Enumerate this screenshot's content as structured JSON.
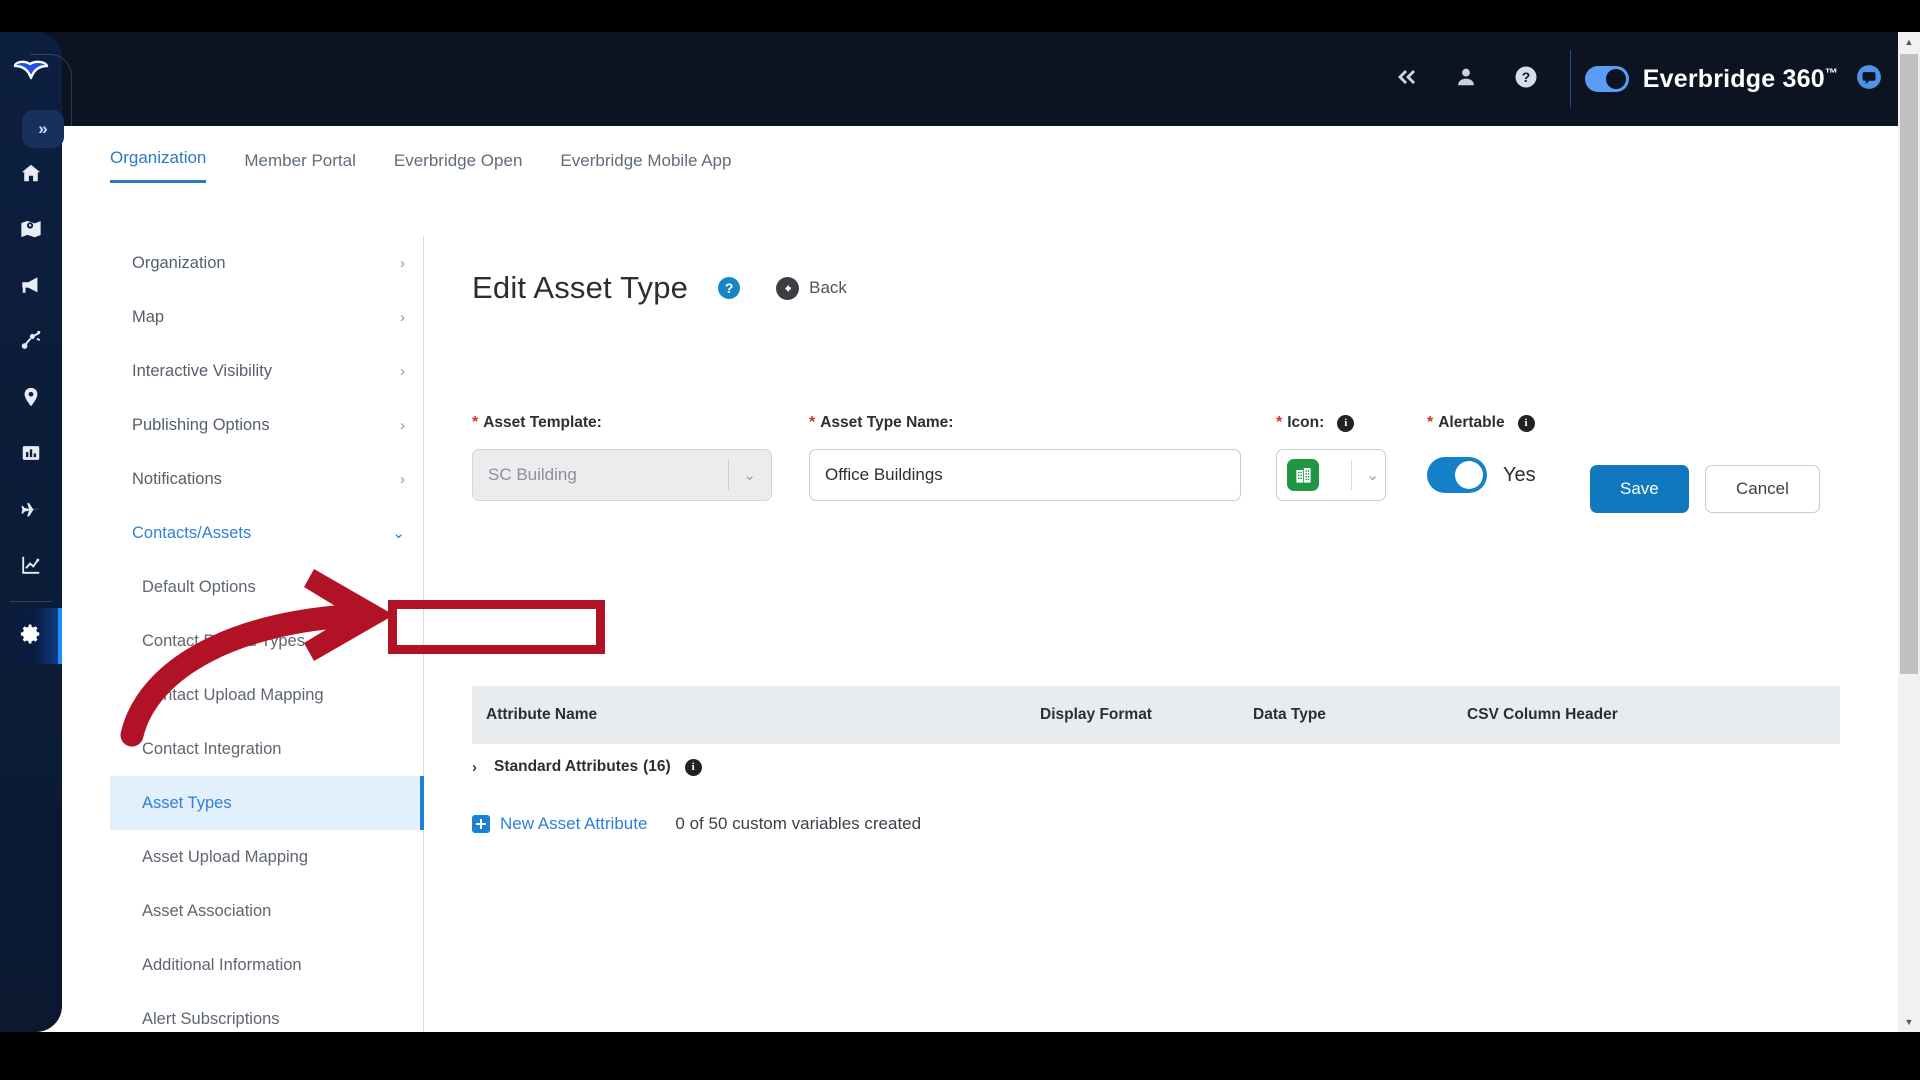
{
  "brand": {
    "name": "Everbridge 360",
    "tm": "™",
    "logo_icon": "everbridge-logo-icon",
    "toggle_on": true
  },
  "topbar": {
    "collapse_icon": "double-chevron-left-icon",
    "user_icon": "user-icon",
    "help_icon": "help-circle-icon",
    "chat_icon": "chat-bubble-icon"
  },
  "rail": {
    "collapse_label": "»",
    "items": [
      {
        "name": "home-icon",
        "label": "Home",
        "active": false
      },
      {
        "name": "map-icon",
        "label": "Map",
        "active": false
      },
      {
        "name": "megaphone-icon",
        "label": "Notifications",
        "active": false
      },
      {
        "name": "workflow-icon",
        "label": "Workflow",
        "active": false
      },
      {
        "name": "location-pin-icon",
        "label": "Location",
        "active": false
      },
      {
        "name": "building-report-icon",
        "label": "Reports",
        "active": false
      },
      {
        "name": "airplane-icon",
        "label": "Travel",
        "active": false
      },
      {
        "name": "analytics-icon",
        "label": "Analytics",
        "active": false
      },
      {
        "name": "gear-icon",
        "label": "Settings",
        "active": true
      }
    ]
  },
  "tabs": [
    {
      "label": "Organization",
      "active": true
    },
    {
      "label": "Member Portal",
      "active": false
    },
    {
      "label": "Everbridge Open",
      "active": false
    },
    {
      "label": "Everbridge Mobile App",
      "active": false
    }
  ],
  "submenu": {
    "groups": [
      {
        "label": "Organization",
        "open": false
      },
      {
        "label": "Map",
        "open": false
      },
      {
        "label": "Interactive Visibility",
        "open": false
      },
      {
        "label": "Publishing Options",
        "open": false
      },
      {
        "label": "Notifications",
        "open": false
      },
      {
        "label": "Contacts/Assets",
        "open": true
      }
    ],
    "items": [
      {
        "label": "Default Options",
        "active": false
      },
      {
        "label": "Contact Record Types",
        "active": false
      },
      {
        "label": "Contact Upload Mapping",
        "active": false
      },
      {
        "label": "Contact Integration",
        "active": false
      },
      {
        "label": "Asset Types",
        "active": true
      },
      {
        "label": "Asset Upload Mapping",
        "active": false
      },
      {
        "label": "Asset Association",
        "active": false
      },
      {
        "label": "Additional Information",
        "active": false
      },
      {
        "label": "Alert Subscriptions",
        "active": false
      }
    ],
    "chevron_right": "›",
    "chevron_down": "⌄"
  },
  "page": {
    "title": "Edit Asset Type",
    "help_label": "?",
    "back_label": "Back",
    "back_icon": "arrow-left-circle-icon"
  },
  "form": {
    "asset_template": {
      "label": "Asset Template:",
      "required_mark": "*",
      "value": "SC Building",
      "disabled": true,
      "caret": "⌄"
    },
    "asset_type_name": {
      "label": "Asset Type Name:",
      "required_mark": "*",
      "value": "Office Buildings",
      "placeholder": "Asset Type Name"
    },
    "icon": {
      "label": "Icon:",
      "required_mark": "*",
      "info": "i",
      "swatch_color": "#1e9642",
      "glyph": "building-icon",
      "caret": "⌄"
    },
    "alertable": {
      "label": "Alertable",
      "required_mark": "*",
      "info": "i",
      "value": "Yes",
      "on": true
    },
    "save_label": "Save",
    "cancel_label": "Cancel"
  },
  "table": {
    "columns": [
      "Attribute Name",
      "Display Format",
      "Data Type",
      "CSV Column Header"
    ],
    "standard_attributes": {
      "label": "Standard Attributes",
      "count": "(16)",
      "caret": "›",
      "info": "i"
    },
    "new_attribute_label": "New Asset Attribute",
    "custom_variable_count": "0 of 50 custom variables created"
  },
  "annotations": {
    "highlight_color": "#b11226",
    "arrow_name": "red-curved-arrow",
    "box_name": "red-highlight-box"
  },
  "scrollbar": {
    "up_arrow": "▲",
    "down_arrow": "▼"
  }
}
